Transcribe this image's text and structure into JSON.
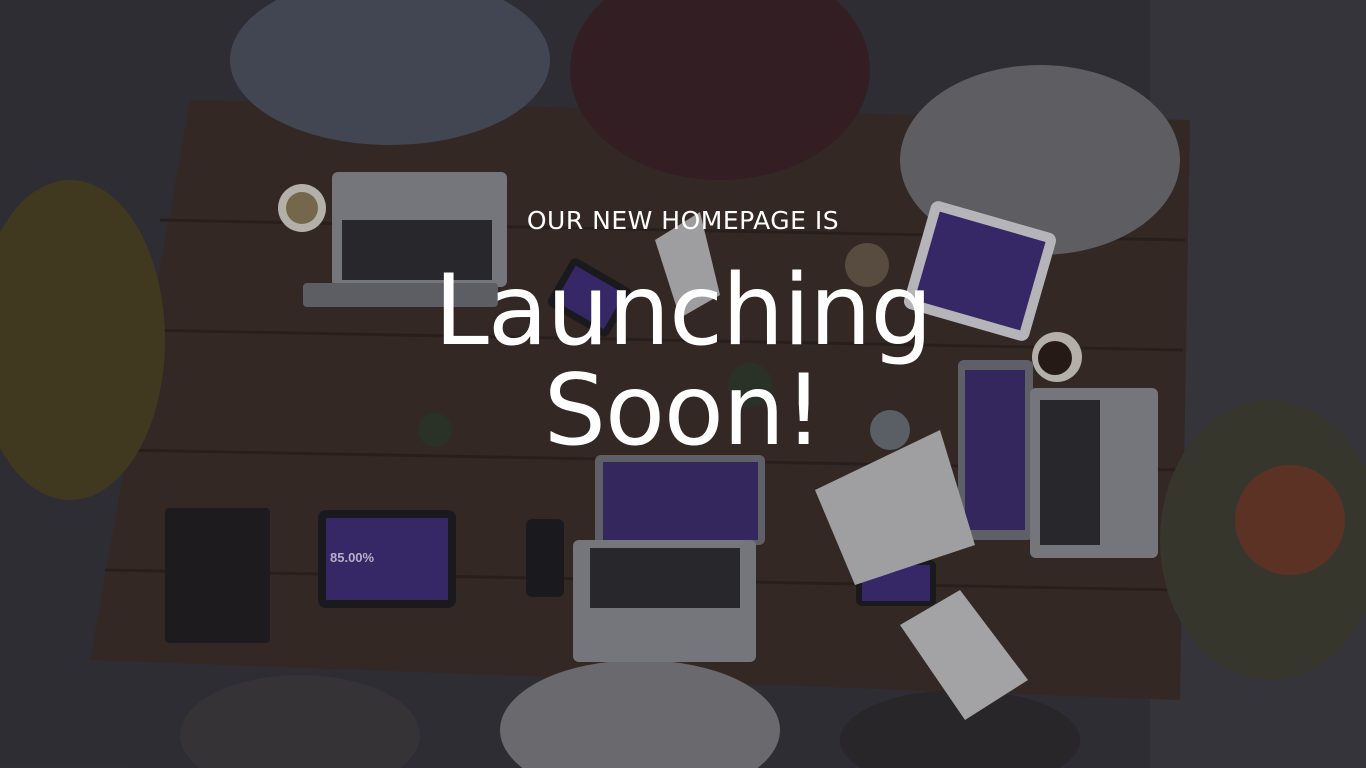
{
  "hero": {
    "kicker": "OUR NEW HOMEPAGE IS",
    "title_line1": "Launching",
    "title_line2": "Soon!",
    "background_image": "team-meeting-photo"
  },
  "colors": {
    "text": "#ffffff",
    "overlay": "#1a181d"
  }
}
